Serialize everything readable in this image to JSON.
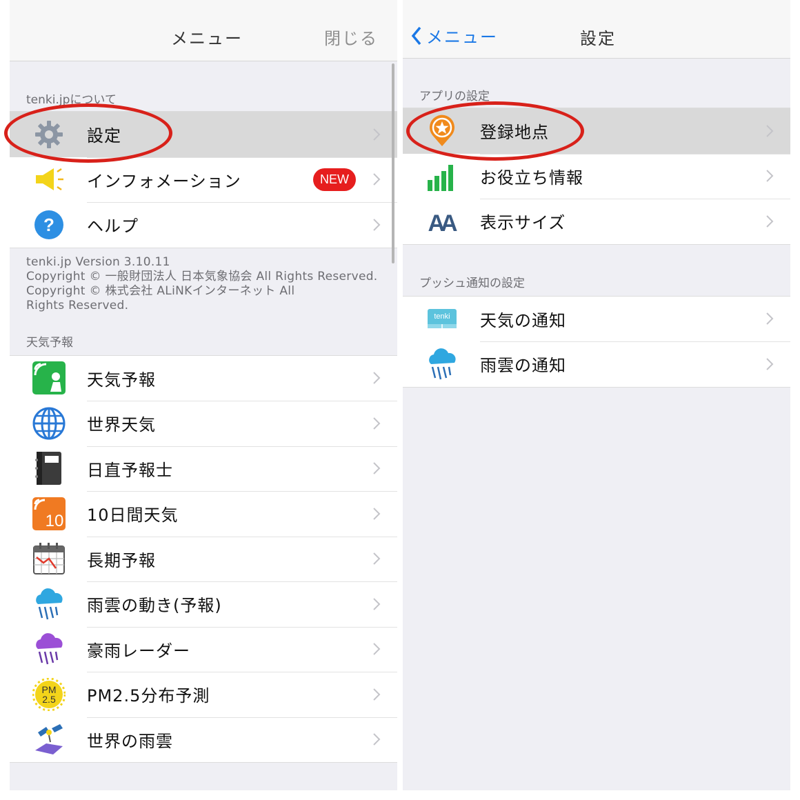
{
  "left": {
    "nav": {
      "title": "メニュー",
      "close": "閉じる"
    },
    "about": {
      "header": "tenki.jpについて",
      "items": [
        {
          "label": "設定",
          "icon": "gear-icon"
        },
        {
          "label": "インフォメーション",
          "icon": "megaphone-icon",
          "badge": "NEW"
        },
        {
          "label": "ヘルプ",
          "icon": "help-icon"
        }
      ],
      "version": "tenki.jp Version 3.10.11",
      "copyright1": "Copyright © 一般財団法人 日本気象協会 All Rights Reserved.",
      "copyright2": "Copyright © 株式会社 ALiNKインターネット All",
      "copyright3": "Rights Reserved."
    },
    "forecast": {
      "header": "天気予報",
      "items": [
        {
          "label": "天気予報",
          "icon": "tenki-forecast-icon"
        },
        {
          "label": "世界天気",
          "icon": "globe-icon"
        },
        {
          "label": "日直予報士",
          "icon": "notebook-icon"
        },
        {
          "label": "10日間天気",
          "icon": "ten-day-icon",
          "icon_text": "10"
        },
        {
          "label": "長期予報",
          "icon": "calendar-icon"
        },
        {
          "label": "雨雲の動き(予報)",
          "icon": "rain-cloud-icon"
        },
        {
          "label": "豪雨レーダー",
          "icon": "heavy-rain-icon"
        },
        {
          "label": "PM2.5分布予測",
          "icon": "pm25-icon",
          "icon_text1": "PM",
          "icon_text2": "2.5"
        },
        {
          "label": "世界の雨雲",
          "icon": "satellite-icon"
        }
      ]
    }
  },
  "right": {
    "nav": {
      "back": "メニュー",
      "title": "設定"
    },
    "app": {
      "header": "アプリの設定",
      "items": [
        {
          "label": "登録地点",
          "icon": "star-pin-icon"
        },
        {
          "label": "お役立ち情報",
          "icon": "signal-bars-icon"
        },
        {
          "label": "表示サイズ",
          "icon": "font-size-icon",
          "icon_text": "AA"
        }
      ]
    },
    "push": {
      "header": "プッシュ通知の設定",
      "items": [
        {
          "label": "天気の通知",
          "icon": "tenki-notify-icon",
          "icon_text": "tenki"
        },
        {
          "label": "雨雲の通知",
          "icon": "rain-cloud-icon"
        }
      ]
    }
  },
  "colors": {
    "accent_blue": "#1a78e6",
    "highlight_red": "#d8211a",
    "badge_red": "#e61e1e"
  }
}
